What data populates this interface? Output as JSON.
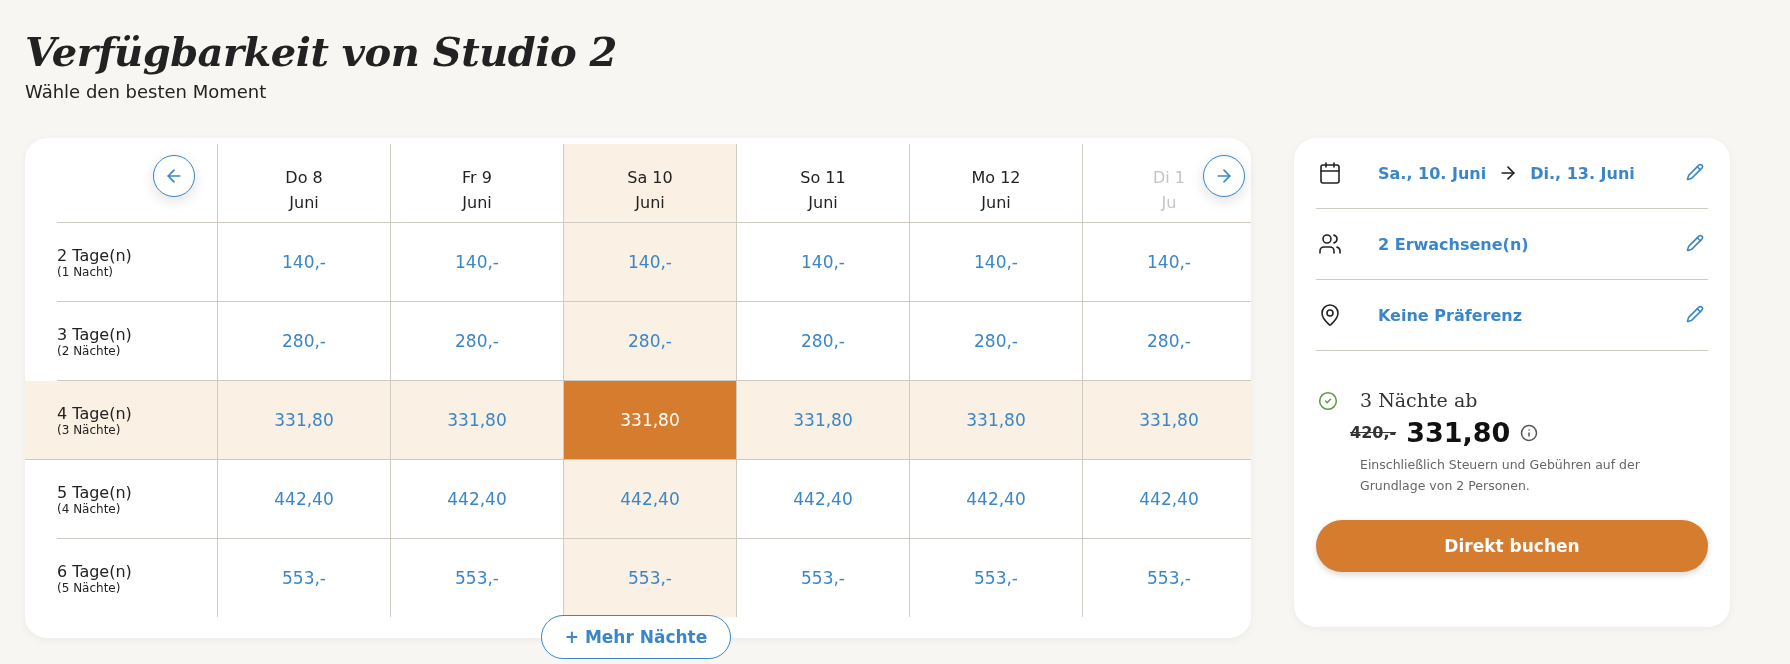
{
  "header": {
    "title": "Verfügbarkeit von Studio 2",
    "subtitle": "Wähle den besten Moment"
  },
  "calendar": {
    "days": [
      {
        "day": "Do 8",
        "month": "Juni",
        "selected": false,
        "faded": false
      },
      {
        "day": "Fr 9",
        "month": "Juni",
        "selected": false,
        "faded": false
      },
      {
        "day": "Sa 10",
        "month": "Juni",
        "selected": true,
        "faded": false
      },
      {
        "day": "So 11",
        "month": "Juni",
        "selected": false,
        "faded": false
      },
      {
        "day": "Mo 12",
        "month": "Juni",
        "selected": false,
        "faded": false
      },
      {
        "day": "Di 1",
        "month": "Ju",
        "selected": false,
        "faded": true
      }
    ],
    "rows": [
      {
        "label": "2 Tage(n)",
        "sublabel": "(1 Nacht)",
        "selected": false,
        "prices": [
          "140,-",
          "140,-",
          "140,-",
          "140,-",
          "140,-",
          "140,-"
        ]
      },
      {
        "label": "3 Tage(n)",
        "sublabel": "(2 Nächte)",
        "selected": false,
        "prices": [
          "280,-",
          "280,-",
          "280,-",
          "280,-",
          "280,-",
          "280,-"
        ]
      },
      {
        "label": "4 Tage(n)",
        "sublabel": "(3 Nächte)",
        "selected": true,
        "prices": [
          "331,80",
          "331,80",
          "331,80",
          "331,80",
          "331,80",
          "331,80"
        ]
      },
      {
        "label": "5 Tage(n)",
        "sublabel": "(4 Nächte)",
        "selected": false,
        "prices": [
          "442,40",
          "442,40",
          "442,40",
          "442,40",
          "442,40",
          "442,40"
        ]
      },
      {
        "label": "6 Tage(n)",
        "sublabel": "(5 Nächte)",
        "selected": false,
        "prices": [
          "553,-",
          "553,-",
          "553,-",
          "553,-",
          "553,-",
          "553,-"
        ]
      }
    ],
    "more_button": "+ Mehr Nächte"
  },
  "booking": {
    "items": [
      {
        "kind": "dates",
        "from": "Sa., 10. Juni",
        "to": "Di., 13. Juni"
      },
      {
        "kind": "guests",
        "text": "2 Erwachsene(n)"
      },
      {
        "kind": "location",
        "text": "Keine Präferenz"
      }
    ],
    "summary": {
      "label": "3 Nächte ab",
      "old_price": "420,-",
      "price": "331,80",
      "note": "Einschließlich Steuern und Gebühren auf der Grundlage von 2 Personen."
    },
    "button": "Direkt buchen"
  }
}
